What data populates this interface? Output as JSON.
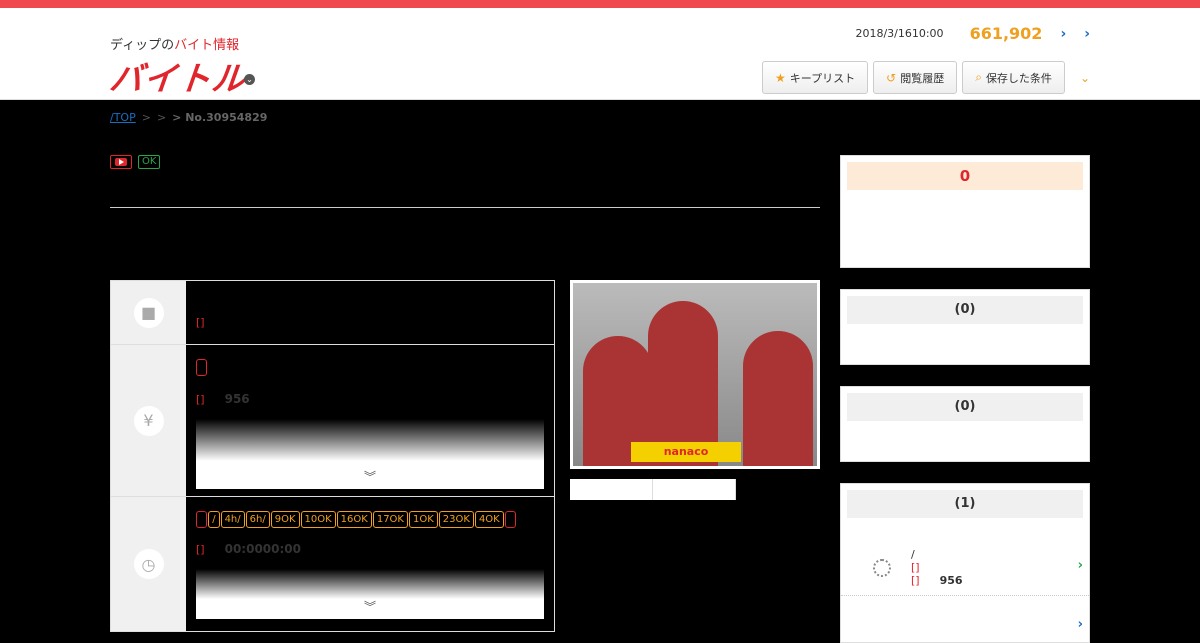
{
  "header": {
    "tagline_pre": "ディップの",
    "tagline_red": "バイト情報",
    "logo": "バイトル",
    "date": "2018/3/1610:00",
    "count": "661,902",
    "nav": [
      {
        "icon": "★",
        "label": "キープリスト"
      },
      {
        "icon": "↺",
        "label": "閲覧履歴"
      },
      {
        "icon": "⌕",
        "label": "保存した条件"
      }
    ]
  },
  "breadcrumb": {
    "top": "/TOP",
    "sep1": ">",
    "sep2": ">",
    "current": "> No.30954829"
  },
  "tags": {
    "ok": "OK"
  },
  "rows": {
    "job_label": "[]",
    "pay_label": "[]",
    "pay_value": "956",
    "time_pills": [
      "/",
      "4h/",
      "6h/",
      "9OK",
      "10OK",
      "16OK",
      "17OK",
      "1OK",
      "23OK",
      "4OK"
    ],
    "time_label": "[]",
    "time_value": "00:0000:00"
  },
  "photo": {
    "sign": "nanaco"
  },
  "sidebar": {
    "box1": "0",
    "box2": "(0)",
    "box3": "(0)",
    "box4": "(1)",
    "item": {
      "line1": "/",
      "line2": "[]",
      "line3": "[]",
      "value": "956"
    }
  }
}
